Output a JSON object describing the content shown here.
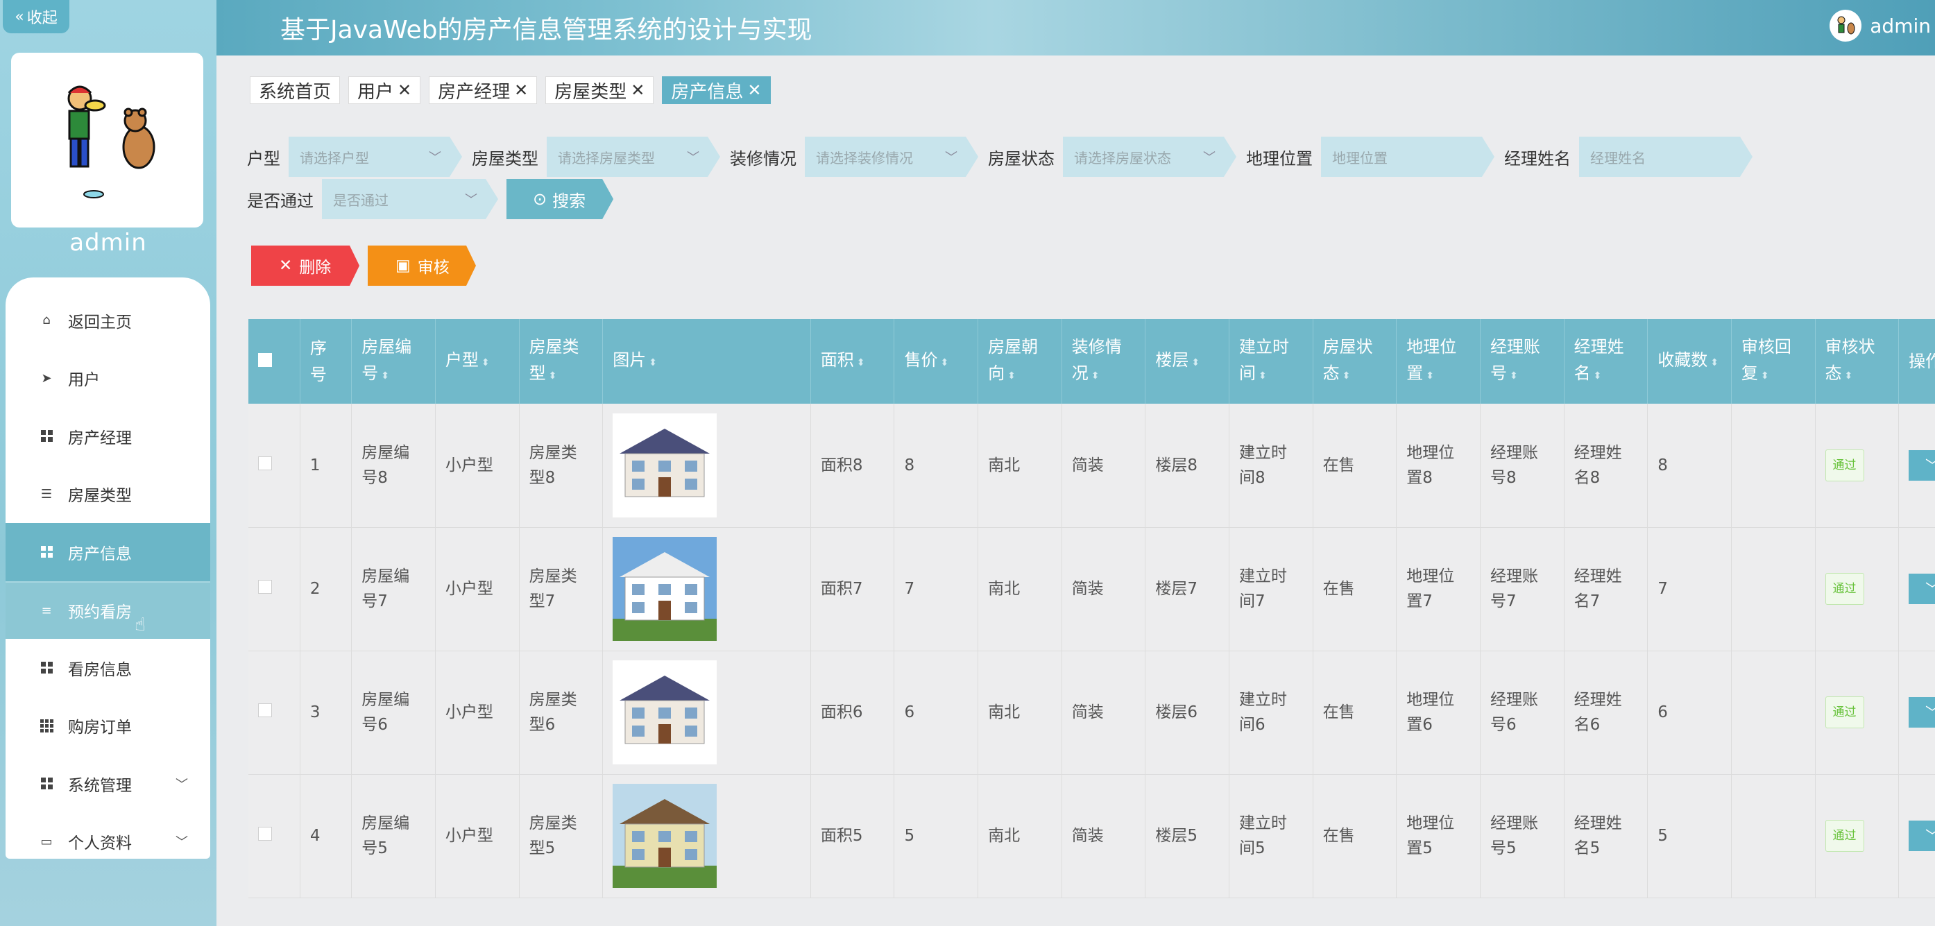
{
  "app": {
    "title": "基于JavaWeb的房产信息管理系统的设计与实现",
    "user": "admin",
    "collapse_label": "收起",
    "sidebar_username": "admin"
  },
  "menu": [
    {
      "label": "返回主页",
      "icon": "home-icon"
    },
    {
      "label": "用户",
      "icon": "send-icon"
    },
    {
      "label": "房产经理",
      "icon": "grid-icon"
    },
    {
      "label": "房屋类型",
      "icon": "sliders-icon"
    },
    {
      "label": "房产信息",
      "icon": "grid-icon",
      "active": true
    },
    {
      "label": "预约看房",
      "icon": "list-icon"
    },
    {
      "label": "看房信息",
      "icon": "grid-icon"
    },
    {
      "label": "购房订单",
      "icon": "grid9-icon"
    },
    {
      "label": "系统管理",
      "icon": "grid-icon",
      "expandable": true
    },
    {
      "label": "个人资料",
      "icon": "card-icon",
      "expandable": true
    }
  ],
  "tabs": [
    {
      "label": "系统首页",
      "closable": false
    },
    {
      "label": "用户",
      "closable": true
    },
    {
      "label": "房产经理",
      "closable": true
    },
    {
      "label": "房屋类型",
      "closable": true
    },
    {
      "label": "房产信息",
      "closable": true,
      "active": true
    }
  ],
  "filters": {
    "huxing": {
      "label": "户型",
      "placeholder": "请选择户型"
    },
    "fangwuleixing": {
      "label": "房屋类型",
      "placeholder": "请选择房屋类型"
    },
    "zhuangxiu": {
      "label": "装修情况",
      "placeholder": "请选择装修情况"
    },
    "zhuangtai": {
      "label": "房屋状态",
      "placeholder": "请选择房屋状态"
    },
    "diliweizhi": {
      "label": "地理位置",
      "placeholder": "地理位置"
    },
    "jinglixingming": {
      "label": "经理姓名",
      "placeholder": "经理姓名"
    },
    "shifoutongguo": {
      "label": "是否通过",
      "placeholder": "是否通过"
    },
    "search_label": "搜索"
  },
  "actions": {
    "delete_label": "删除",
    "audit_label": "审核"
  },
  "table": {
    "headers": [
      "序号",
      "房屋编号",
      "户型",
      "房屋类型",
      "图片",
      "面积",
      "售价",
      "房屋朝向",
      "装修情况",
      "楼层",
      "建立时间",
      "房屋状态",
      "地理位置",
      "经理账号",
      "经理姓名",
      "收藏数",
      "审核回复",
      "审核状态",
      "操作"
    ],
    "rows": [
      {
        "no": "1",
        "bianhao": "房屋编号8",
        "huxing": "小户型",
        "leixing": "房屋类型8",
        "img": "house-villa",
        "mianji": "面积8",
        "shoujia": "8",
        "chaoxiang": "南北",
        "zhuangxiu": "简装",
        "louceng": "楼层8",
        "jianli": "建立时间8",
        "zhuangtai": "在售",
        "weizhi": "地理位置8",
        "zhanghao": "经理账号8",
        "xingming": "经理姓名8",
        "shoucang": "8",
        "huifu": "",
        "shenhe": "通过"
      },
      {
        "no": "2",
        "bianhao": "房屋编号7",
        "huxing": "小户型",
        "leixing": "房屋类型7",
        "img": "house-cottage",
        "mianji": "面积7",
        "shoujia": "7",
        "chaoxiang": "南北",
        "zhuangxiu": "简装",
        "louceng": "楼层7",
        "jianli": "建立时间7",
        "zhuangtai": "在售",
        "weizhi": "地理位置7",
        "zhanghao": "经理账号7",
        "xingming": "经理姓名7",
        "shoucang": "7",
        "huifu": "",
        "shenhe": "通过"
      },
      {
        "no": "3",
        "bianhao": "房屋编号6",
        "huxing": "小户型",
        "leixing": "房屋类型6",
        "img": "house-villa",
        "mianji": "面积6",
        "shoujia": "6",
        "chaoxiang": "南北",
        "zhuangxiu": "简装",
        "louceng": "楼层6",
        "jianli": "建立时间6",
        "zhuangtai": "在售",
        "weizhi": "地理位置6",
        "zhanghao": "经理账号6",
        "xingming": "经理姓名6",
        "shoucang": "6",
        "huifu": "",
        "shenhe": "通过"
      },
      {
        "no": "4",
        "bianhao": "房屋编号5",
        "huxing": "小户型",
        "leixing": "房屋类型5",
        "img": "house-green",
        "mianji": "面积5",
        "shoujia": "5",
        "chaoxiang": "南北",
        "zhuangxiu": "简装",
        "louceng": "楼层5",
        "jianli": "建立时间5",
        "zhuangtai": "在售",
        "weizhi": "地理位置5",
        "zhanghao": "经理账号5",
        "xingming": "经理姓名5",
        "shoucang": "5",
        "huifu": "",
        "shenhe": "通过"
      }
    ]
  },
  "colors": {
    "accent": "#6bb6c7",
    "header_th": "#71b9ca",
    "danger": "#ef4347",
    "warning": "#f49016",
    "success": "#67c23a"
  }
}
